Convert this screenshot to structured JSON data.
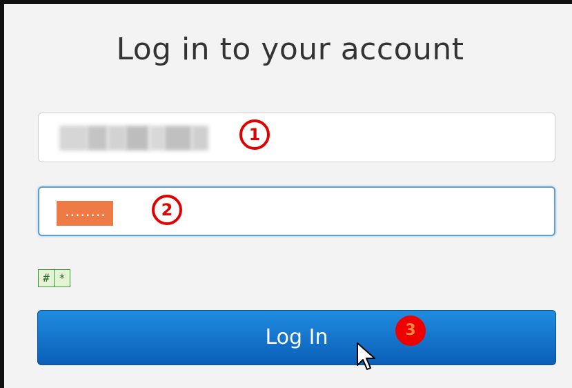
{
  "form": {
    "title": "Log in to your account",
    "password_mask": "........",
    "login_label": "Log In"
  },
  "show_hide_toggles": [
    "#",
    "*"
  ],
  "annotations": [
    "1",
    "2",
    "3"
  ],
  "colors": {
    "button_top": "#1f8ce0",
    "button_bottom": "#0c5fb7",
    "focus_border": "#5aa1dc",
    "marker": "#e00000",
    "password_highlight": "#ee7a45"
  }
}
